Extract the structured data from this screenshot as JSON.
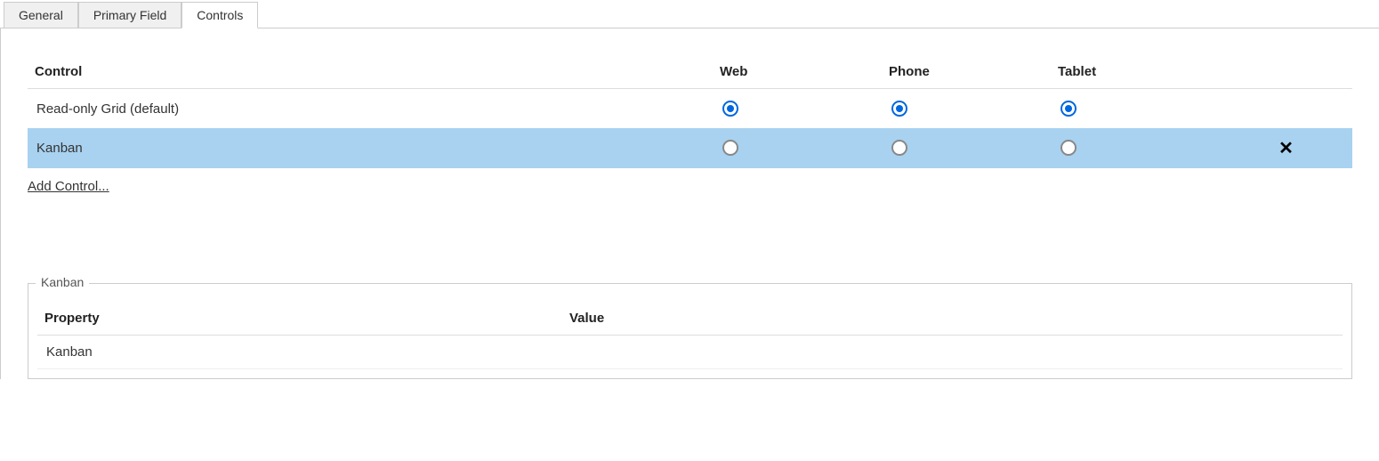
{
  "tabs": [
    {
      "label": "General",
      "active": false
    },
    {
      "label": "Primary Field",
      "active": false
    },
    {
      "label": "Controls",
      "active": true
    }
  ],
  "controls_table": {
    "headers": {
      "control": "Control",
      "web": "Web",
      "phone": "Phone",
      "tablet": "Tablet"
    },
    "rows": [
      {
        "name": "Read-only Grid (default)",
        "web": true,
        "phone": true,
        "tablet": true,
        "selected": false,
        "deletable": false
      },
      {
        "name": "Kanban",
        "web": false,
        "phone": false,
        "tablet": false,
        "selected": true,
        "deletable": true
      }
    ],
    "add_control_label": "Add Control..."
  },
  "details": {
    "legend": "Kanban",
    "headers": {
      "property": "Property",
      "value": "Value"
    },
    "rows": [
      {
        "property": "Kanban",
        "value": ""
      }
    ]
  }
}
